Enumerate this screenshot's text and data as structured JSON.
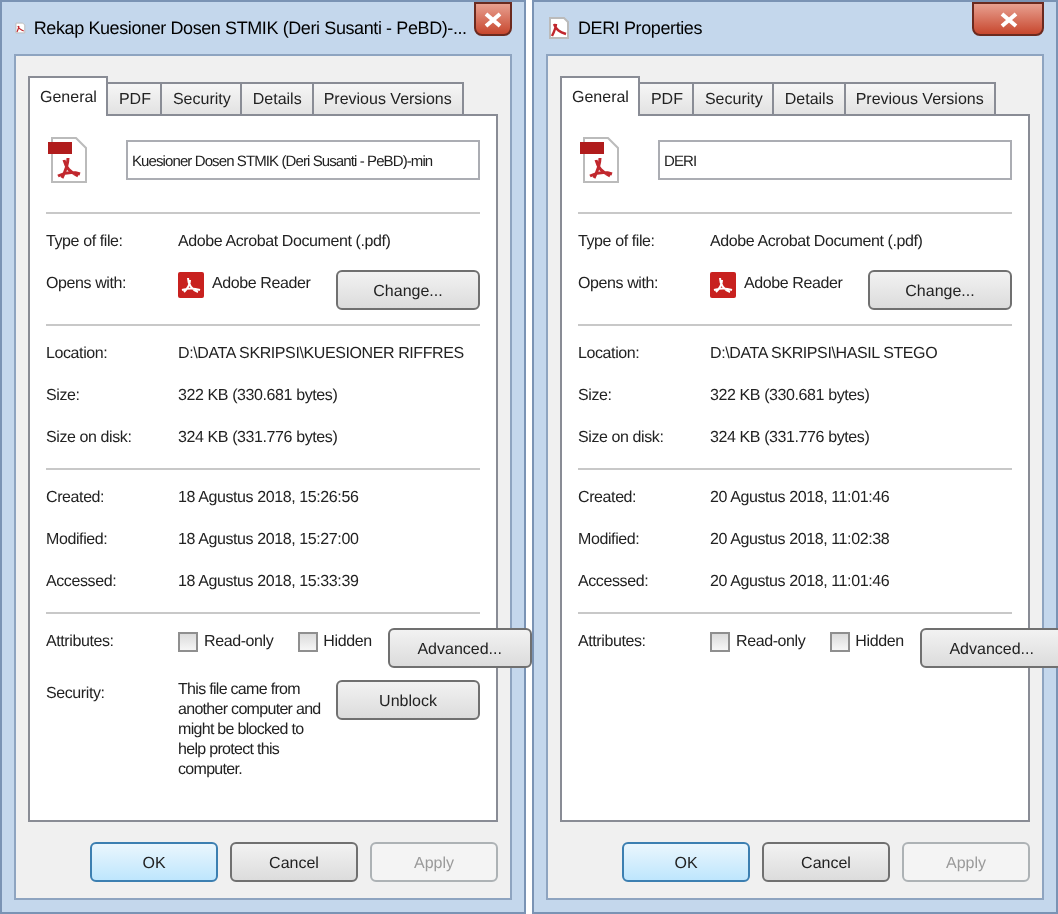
{
  "dialogs": [
    {
      "title": "Rekap Kuesioner Dosen STMIK (Deri Susanti - PeBD)-...",
      "tabs": [
        {
          "label": "General",
          "selected": true
        },
        {
          "label": "PDF",
          "selected": false
        },
        {
          "label": "Security",
          "selected": false
        },
        {
          "label": "Details",
          "selected": false
        },
        {
          "label": "Previous Versions",
          "selected": false
        }
      ],
      "filename": "Kuesioner Dosen STMIK (Deri Susanti - PeBD)-min",
      "sections": [
        [
          {
            "kind": "text",
            "label": "Type of file:",
            "value": "Adobe Acrobat Document (.pdf)"
          },
          {
            "kind": "app",
            "label": "Opens with:",
            "value": "Adobe Reader",
            "button": "Change..."
          }
        ],
        [
          {
            "kind": "text",
            "label": "Location:",
            "value": "D:\\DATA SKRIPSI\\KUESIONER RIFFRES"
          },
          {
            "kind": "text",
            "label": "Size:",
            "value": "322 KB (330.681 bytes)"
          },
          {
            "kind": "text",
            "label": "Size on disk:",
            "value": "324 KB (331.776 bytes)"
          }
        ],
        [
          {
            "kind": "text",
            "label": "Created:",
            "value": "18 Agustus 2018, 15:26:56"
          },
          {
            "kind": "text",
            "label": "Modified:",
            "value": "18 Agustus 2018, 15:27:00"
          },
          {
            "kind": "text",
            "label": "Accessed:",
            "value": "18 Agustus 2018, 15:33:39"
          }
        ],
        [
          {
            "kind": "attributes",
            "label": "Attributes:",
            "checks": [
              {
                "label": "Read-only",
                "checked": false
              },
              {
                "label": "Hidden",
                "checked": false
              }
            ],
            "button": "Advanced..."
          },
          {
            "kind": "security",
            "label": "Security:",
            "value": "This file came from another computer and might be blocked to help protect this computer.",
            "button": "Unblock"
          }
        ]
      ],
      "buttons": [
        {
          "label": "OK",
          "default": true,
          "disabled": false
        },
        {
          "label": "Cancel",
          "default": false,
          "disabled": false
        },
        {
          "label": "Apply",
          "default": false,
          "disabled": true
        }
      ]
    },
    {
      "title": "DERI Properties",
      "tabs": [
        {
          "label": "General",
          "selected": true
        },
        {
          "label": "PDF",
          "selected": false
        },
        {
          "label": "Security",
          "selected": false
        },
        {
          "label": "Details",
          "selected": false
        },
        {
          "label": "Previous Versions",
          "selected": false
        }
      ],
      "filename": "DERI",
      "sections": [
        [
          {
            "kind": "text",
            "label": "Type of file:",
            "value": "Adobe Acrobat Document (.pdf)"
          },
          {
            "kind": "app",
            "label": "Opens with:",
            "value": "Adobe Reader",
            "button": "Change..."
          }
        ],
        [
          {
            "kind": "text",
            "label": "Location:",
            "value": "D:\\DATA SKRIPSI\\HASIL STEGO"
          },
          {
            "kind": "text",
            "label": "Size:",
            "value": "322 KB (330.681 bytes)"
          },
          {
            "kind": "text",
            "label": "Size on disk:",
            "value": "324 KB (331.776 bytes)"
          }
        ],
        [
          {
            "kind": "text",
            "label": "Created:",
            "value": "20 Agustus 2018, 11:01:46"
          },
          {
            "kind": "text",
            "label": "Modified:",
            "value": "20 Agustus 2018, 11:02:38"
          },
          {
            "kind": "text",
            "label": "Accessed:",
            "value": "20 Agustus 2018, 11:01:46"
          }
        ],
        [
          {
            "kind": "attributes",
            "label": "Attributes:",
            "checks": [
              {
                "label": "Read-only",
                "checked": false
              },
              {
                "label": "Hidden",
                "checked": false
              }
            ],
            "button": "Advanced..."
          }
        ]
      ],
      "buttons": [
        {
          "label": "OK",
          "default": true,
          "disabled": false
        },
        {
          "label": "Cancel",
          "default": false,
          "disabled": false
        },
        {
          "label": "Apply",
          "default": false,
          "disabled": true
        }
      ]
    }
  ]
}
